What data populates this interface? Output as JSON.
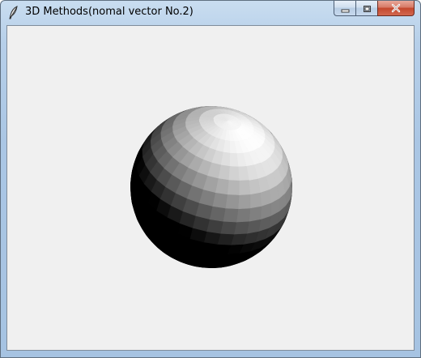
{
  "window": {
    "title": "3D Methods(nomal vector No.2)",
    "app_icon": "feather-icon",
    "controls": {
      "minimize_icon": "minimize-icon",
      "maximize_icon": "maximize-icon",
      "close_icon": "close-icon"
    }
  },
  "canvas": {
    "background": "#f0f0f0",
    "object": "shaded-sphere",
    "shading": "flat-faceted grayscale, light from upper right"
  }
}
